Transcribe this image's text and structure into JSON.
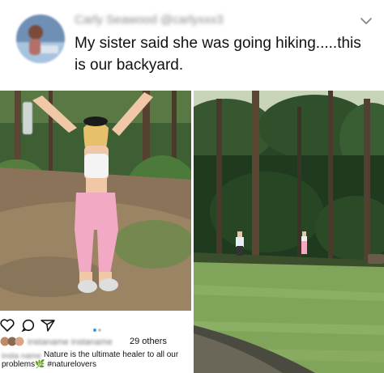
{
  "post": {
    "username_blurred": "Carly Seawood @carlyxxx3",
    "text": "My sister said she was going hiking.....this is our backyard."
  },
  "instagram": {
    "likes_blurred": "instaname instaname",
    "likes_count": "29 others",
    "caption_user_blurred": "insta name",
    "caption": "Nature is the ultimate healer to all our problems🌿 #naturelovers"
  },
  "icons": {
    "more": "chevron-down-icon",
    "like": "heart-icon",
    "comment": "comment-icon",
    "share": "send-icon"
  },
  "colors": {
    "leggings": "#f2a9c4",
    "grass": "#7fa45a",
    "forest": "#1f3a1e"
  }
}
